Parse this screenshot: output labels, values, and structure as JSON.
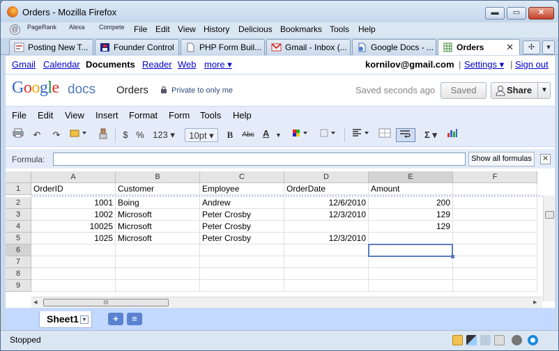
{
  "window": {
    "title": "Orders - Mozilla Firefox",
    "min_glyph": "▬",
    "max_glyph": "▭",
    "close_glyph": "✕"
  },
  "firefox_menu": {
    "extensions": [
      "PageRank",
      "Alexa",
      "Compete"
    ],
    "items": [
      "File",
      "Edit",
      "View",
      "History",
      "Delicious",
      "Bookmarks",
      "Tools",
      "Help"
    ]
  },
  "tabs": [
    {
      "label": "Posting New T...",
      "icon": "blogger-icon"
    },
    {
      "label": "Founder Control",
      "icon": "site-icon"
    },
    {
      "label": "PHP Form Buil...",
      "icon": "page-icon"
    },
    {
      "label": "Gmail - Inbox (...",
      "icon": "gmail-icon"
    },
    {
      "label": "Google Docs - ...",
      "icon": "docs-icon"
    },
    {
      "label": "Orders",
      "icon": "spreadsheet-icon",
      "active": true
    }
  ],
  "tab_close": "✕",
  "gbar": {
    "links": [
      "Gmail",
      "Calendar",
      "Documents",
      "Reader",
      "Web",
      "more ▾"
    ],
    "user": "kornilov@gmail.com",
    "settings": "Settings ▾",
    "sep": "|",
    "signout": "Sign out"
  },
  "header": {
    "logo_google": "Google",
    "logo_docs": "docs",
    "doc_title": "Orders",
    "privacy": "Private to only me",
    "saved_status": "Saved seconds ago",
    "saved_button": "Saved",
    "share_button": "Share"
  },
  "doc_menu": [
    "File",
    "Edit",
    "View",
    "Insert",
    "Format",
    "Form",
    "Tools",
    "Help"
  ],
  "toolbar": {
    "dollar": "$",
    "percent": "%",
    "numfmt": "123 ▾",
    "fontsize": "10pt ▾",
    "bold": "B",
    "strike": "Abc",
    "textcolor": "A",
    "sigma": "Σ ▾"
  },
  "formula": {
    "label": "Formula:",
    "value": "",
    "show_all": "Show all formulas",
    "close": "✕"
  },
  "grid": {
    "columns": [
      "A",
      "B",
      "C",
      "D",
      "E",
      "F"
    ],
    "selected_column": "E",
    "selected_row": 6,
    "rows": [
      {
        "n": "1",
        "cells": [
          "OrderID",
          "Customer",
          "Employee",
          "OrderDate",
          "Amount",
          ""
        ]
      },
      {
        "n": "2",
        "cells": [
          "1001",
          "Boing",
          "Andrew",
          "12/6/2010",
          "200",
          ""
        ]
      },
      {
        "n": "3",
        "cells": [
          "1002",
          "Microsoft",
          "Peter Crosby",
          "12/3/2010",
          "129",
          ""
        ]
      },
      {
        "n": "4",
        "cells": [
          "10025",
          "Microsoft",
          "Peter Crosby",
          "",
          "129",
          ""
        ]
      },
      {
        "n": "5",
        "cells": [
          "1025",
          "Microsoft",
          "Peter Crosby",
          "12/3/2010",
          "",
          ""
        ]
      },
      {
        "n": "6",
        "cells": [
          "",
          "",
          "",
          "",
          "",
          ""
        ]
      },
      {
        "n": "7",
        "cells": [
          "",
          "",
          "",
          "",
          "",
          ""
        ]
      },
      {
        "n": "8",
        "cells": [
          "",
          "",
          "",
          "",
          "",
          ""
        ]
      },
      {
        "n": "9",
        "cells": [
          "",
          "",
          "",
          "",
          "",
          ""
        ]
      }
    ]
  },
  "scroll": {
    "left_arrow": "◂",
    "right_arrow": "▸",
    "thumb_grip": "III"
  },
  "sheets": {
    "active": "Sheet1",
    "dropdown": "▾",
    "add": "+",
    "list": "≡"
  },
  "status": {
    "text": "Stopped"
  },
  "colors": {
    "docs_blue": "#c3d9ff",
    "toolbar_bg": "#e5ecf9",
    "link": "#0000cc",
    "selection": "#5a7bbf"
  }
}
